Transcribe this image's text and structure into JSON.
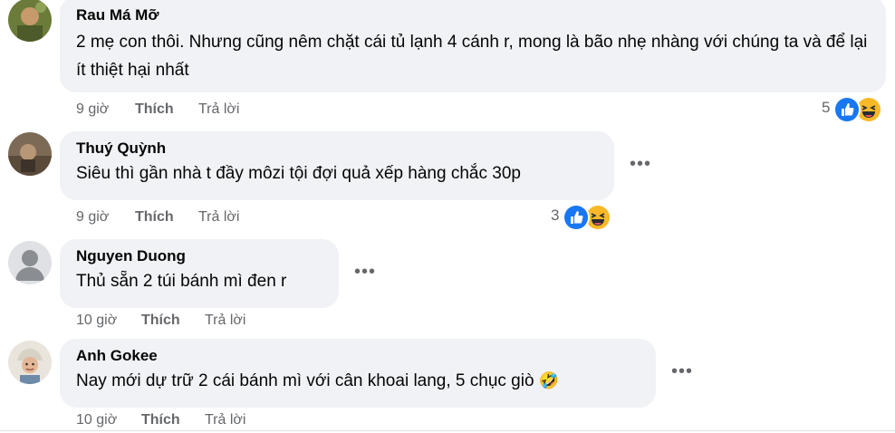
{
  "comments": [
    {
      "author": "Rau Má Mỡ",
      "text": "2 mẹ con thôi. Nhưng cũng nêm chặt cái tủ lạnh 4 cánh r, mong là bão nhẹ nhàng với chúng ta và để lại ít thiệt hại nhất",
      "time": "9 giờ",
      "like_label": "Thích",
      "reply_label": "Trả lời",
      "reaction_count": "5",
      "reactions": [
        "like-icon",
        "haha-icon"
      ]
    },
    {
      "author": "Thuý Quỳnh",
      "text": "Siêu thì gần nhà t đầy môzi tội đợi quả xếp hàng chắc 30p",
      "time": "9 giờ",
      "like_label": "Thích",
      "reply_label": "Trả lời",
      "reaction_count": "3",
      "reactions": [
        "like-icon",
        "haha-icon"
      ]
    },
    {
      "author": "Nguyen Duong",
      "text": "Thủ sẵn 2 túi bánh mì đen r",
      "time": "10 giờ",
      "like_label": "Thích",
      "reply_label": "Trả lời"
    },
    {
      "author": "Anh Gokee",
      "text": "Nay mới dự trữ 2 cái bánh mì với cân khoai lang, 5 chục giò",
      "emoji": "🤣",
      "time": "10 giờ",
      "like_label": "Thích",
      "reply_label": "Trả lời"
    }
  ],
  "more_options_label": "•••",
  "colors": {
    "bubble": "#f0f2f5",
    "meta_text": "#65676b",
    "like_blue": "#1877f2",
    "haha_yellow": "#f7b928"
  }
}
